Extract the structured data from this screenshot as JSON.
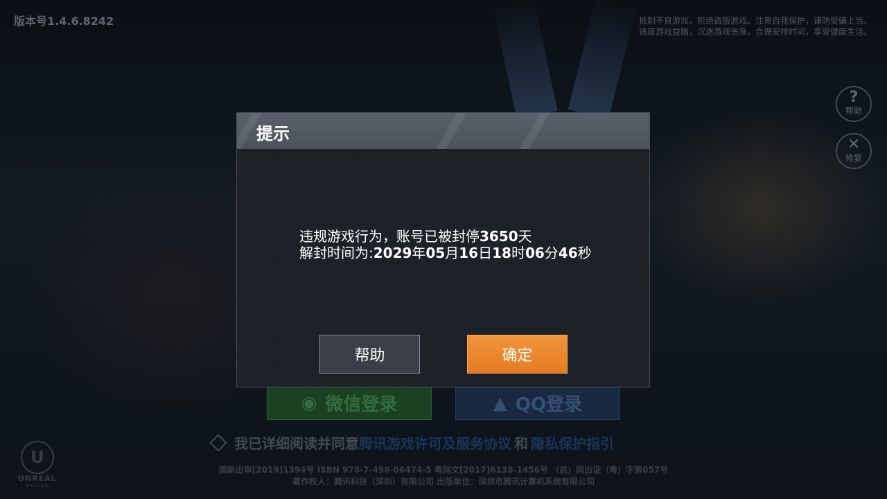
{
  "app": {
    "version_label": "版本号",
    "version_number": "1.4.6.8242",
    "health_notice_line1": "抵制不良游戏，拒绝盗版游戏。注意自我保护，谨防受骗上当。",
    "health_notice_line2": "适度游戏益脑，沉迷游戏伤身。合理安排时间，享受健康生活。"
  },
  "side_buttons": {
    "help": {
      "label": "帮助",
      "icon": "question-mark-icon"
    },
    "repair": {
      "label": "修复",
      "icon": "wrench-screwdriver-icon"
    }
  },
  "login": {
    "wechat_label": "微信登录",
    "qq_label": "QQ登录"
  },
  "agreement": {
    "prefix": "我已详细阅读并同意",
    "link1": "腾讯游戏许可及服务协议",
    "and": "和",
    "link2": "隐私保护指引"
  },
  "footer": {
    "line1": "国新出审[2019]1394号 ISBN 978-7-498-06474-5 粤网文[2017]6138-1456号 （总）网出证（粤）字第057号",
    "line2": "著作权人：腾讯科技（深圳）有限公司 出版单位：深圳市腾讯计算机系统有限公司"
  },
  "engine_logo": {
    "name": "UNREAL",
    "sub": "ENGINE"
  },
  "dialog": {
    "title": "提示",
    "line1_text": "违规游戏行为，账号已被封停",
    "line1_days": "3650",
    "line1_unit": "天",
    "line2_label": "解封时间为:",
    "year": "2029",
    "year_unit": "年",
    "month": "05",
    "month_unit": "月",
    "day": "16",
    "day_unit": "日",
    "hour": "18",
    "hour_unit": "时",
    "minute": "06",
    "minute_unit": "分",
    "second": "46",
    "second_unit": "秒",
    "help_button": "帮助",
    "ok_button": "确定"
  },
  "colors": {
    "ok_button": "#e98a2e",
    "help_button": "#3a3f49",
    "dialog_header": "#545b64"
  }
}
